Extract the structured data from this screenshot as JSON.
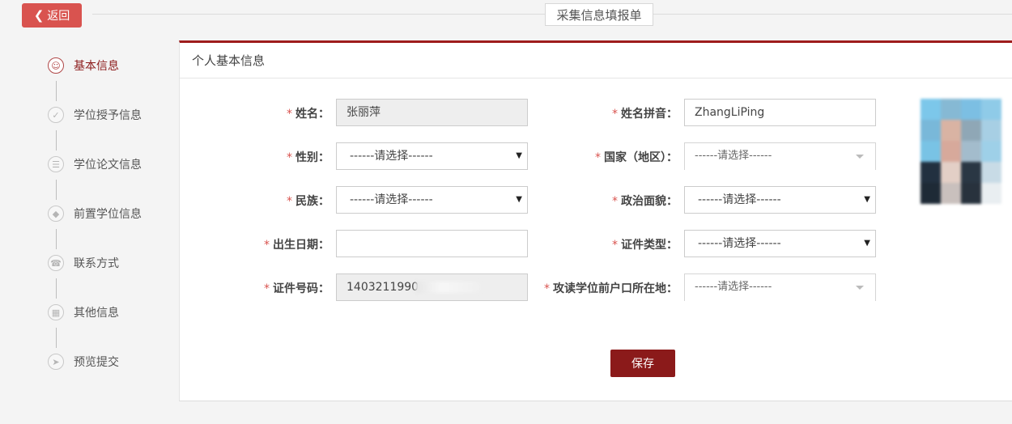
{
  "header": {
    "back_label": "返回",
    "back_icon": "chevron-left-icon",
    "page_title": "采集信息填报单",
    "accent_color": "#d9534f"
  },
  "steps": [
    {
      "label": "基本信息",
      "icon": "user-icon",
      "active": true
    },
    {
      "label": "学位授予信息",
      "icon": "shield-icon",
      "active": false
    },
    {
      "label": "学位论文信息",
      "icon": "document-icon",
      "active": false
    },
    {
      "label": "前置学位信息",
      "icon": "graduation-cap-icon",
      "active": false
    },
    {
      "label": "联系方式",
      "icon": "phone-icon",
      "active": false
    },
    {
      "label": "其他信息",
      "icon": "file-icon",
      "active": false
    },
    {
      "label": "预览提交",
      "icon": "send-icon",
      "active": false
    }
  ],
  "panel": {
    "title": "个人基本信息",
    "brand_color": "#8b1a1a"
  },
  "form": {
    "required_mark": "*",
    "name": {
      "label": "姓名：",
      "value": "张丽萍"
    },
    "name_pinyin": {
      "label": "姓名拼音：",
      "value": "ZhangLiPing"
    },
    "gender": {
      "label": "性别：",
      "value": "------请选择------"
    },
    "country": {
      "label": "国家（地区）：",
      "value": "------请选择------"
    },
    "ethnicity": {
      "label": "民族：",
      "value": "------请选择------"
    },
    "political_status": {
      "label": "政治面貌：",
      "value": "------请选择------"
    },
    "birth_date": {
      "label": "出生日期：",
      "value": ""
    },
    "id_type": {
      "label": "证件类型：",
      "value": "------请选择------"
    },
    "id_number": {
      "label": "证件号码：",
      "value": "1403211990"
    },
    "hukou": {
      "label": "攻读学位前户口所在地：",
      "value": "------请选择------"
    }
  },
  "actions": {
    "save_label": "保存"
  }
}
